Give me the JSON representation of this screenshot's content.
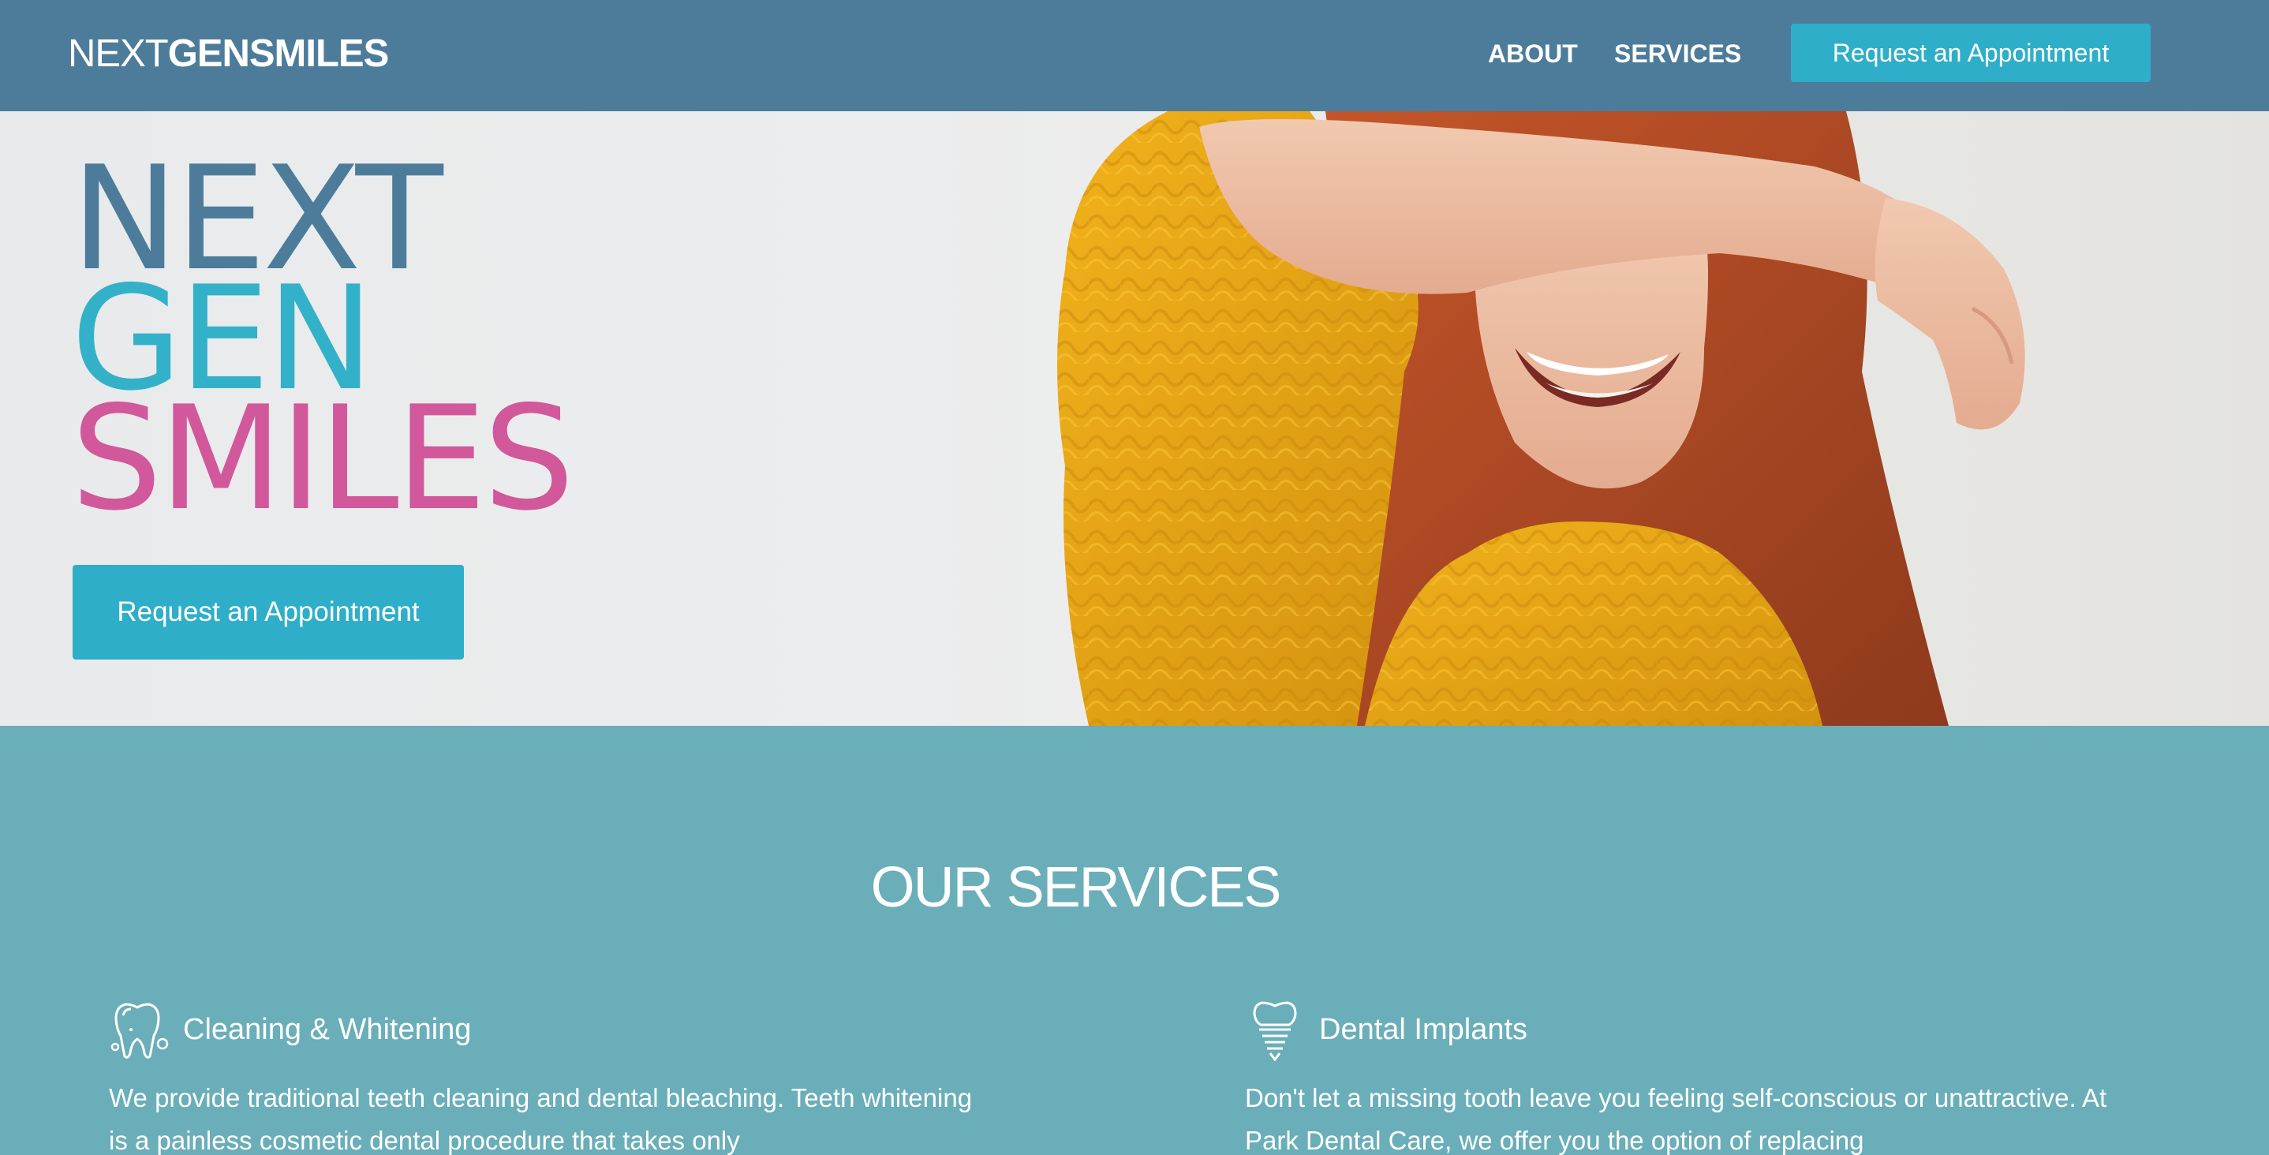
{
  "nav": {
    "logo": {
      "part1": "NEXT",
      "part2": "GEN",
      "part3": "SMILES"
    },
    "links": [
      {
        "label": "ABOUT"
      },
      {
        "label": "SERVICES"
      }
    ],
    "cta_label": "Request an Appointment"
  },
  "hero": {
    "title_line1": "NEXT",
    "title_line2": "GEN",
    "title_line3": "SMILES",
    "cta_label": "Request an Appointment",
    "photo": "smiling woman in yellow sweater covering eyes with arm"
  },
  "services": {
    "title": "OUR SERVICES",
    "items": [
      {
        "icon": "tooth-sparkle-icon",
        "name": "Cleaning & Whitening",
        "text": "We provide traditional teeth cleaning and dental bleaching. Teeth whitening is a painless cosmetic dental procedure that takes only"
      },
      {
        "icon": "dental-implant-icon",
        "name": "Dental Implants",
        "text": "Don't let a missing tooth leave you feeling self-conscious or unattractive. At Park Dental Care, we offer you the option of replacing"
      }
    ]
  },
  "colors": {
    "nav_bg": "#4d7c9b",
    "accent": "#2eaec9",
    "services_bg": "#6aaeb9",
    "title_blue": "#4d7c9b",
    "title_teal": "#33b1c8",
    "title_pink": "#d1589a"
  }
}
